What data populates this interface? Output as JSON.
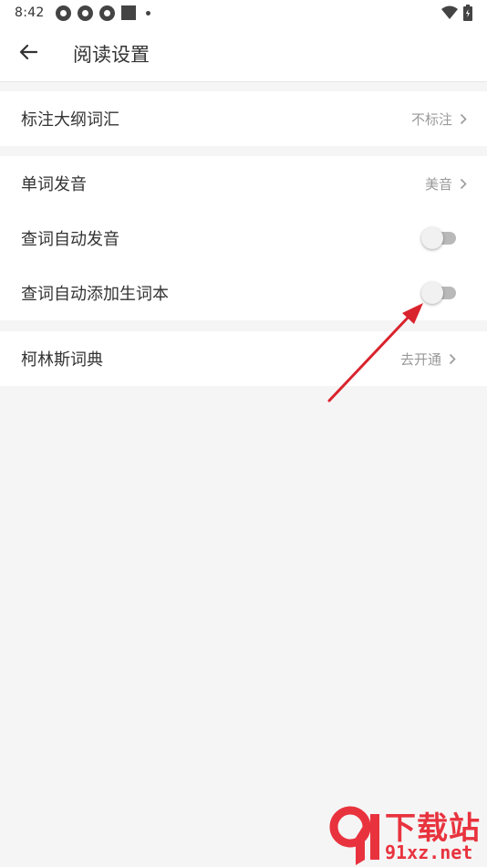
{
  "status_bar": {
    "time": "8:42",
    "notification_icons": [
      "app-notification-icon",
      "app-notification-icon",
      "app-notification-icon",
      "square-icon",
      "dot-icon"
    ],
    "right_icons": [
      "wifi-icon",
      "battery-icon"
    ]
  },
  "header": {
    "back_icon": "arrow-left-icon",
    "title": "阅读设置"
  },
  "group1": {
    "rows": [
      {
        "label": "标注大纲词汇",
        "value": "不标注"
      }
    ]
  },
  "group2": {
    "rows": [
      {
        "label": "单词发音",
        "value": "美音"
      },
      {
        "label": "查词自动发音",
        "toggle_on": false
      },
      {
        "label": "查词自动添加生词本",
        "toggle_on": false
      }
    ]
  },
  "group3": {
    "rows": [
      {
        "label": "柯林斯词典",
        "value": "去开通"
      }
    ]
  },
  "annotation": {
    "color": "#d9232d"
  },
  "watermark": {
    "brand": "下载站",
    "url": "91xz.net",
    "color": "#e8333e"
  }
}
